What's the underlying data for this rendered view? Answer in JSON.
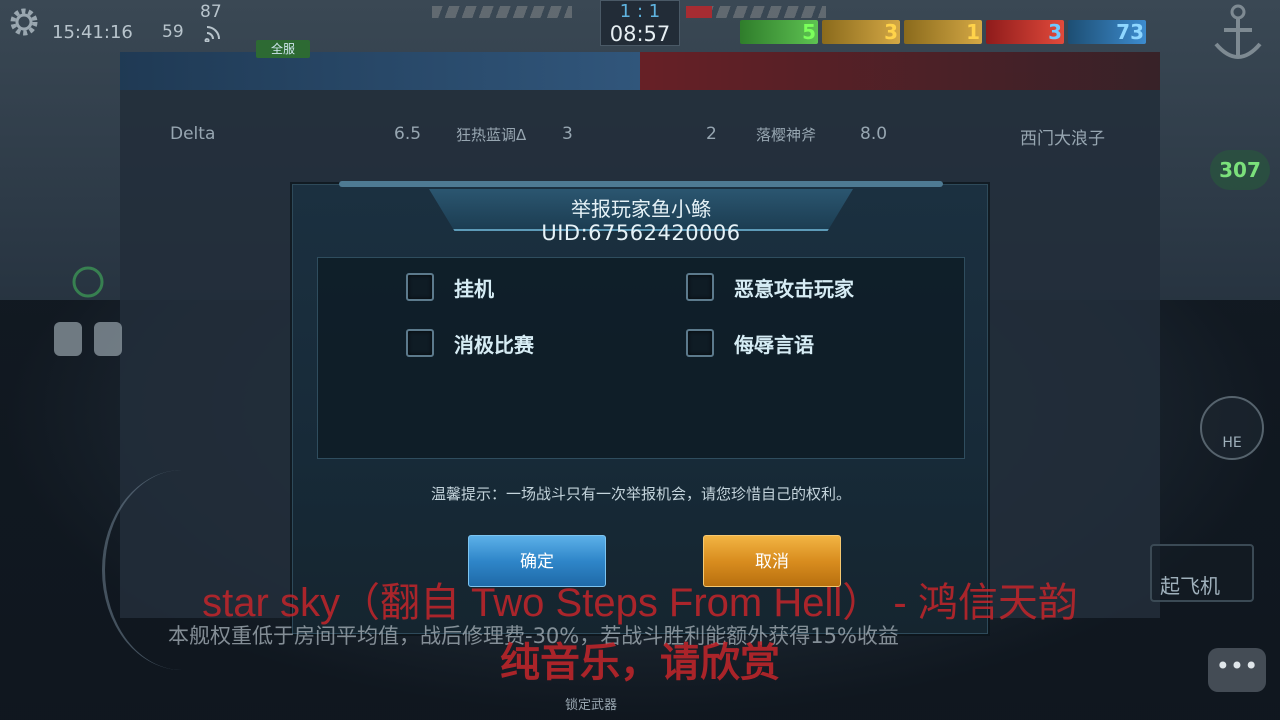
{
  "hud": {
    "clock": "15:41:16",
    "ping": "59",
    "fps": "87",
    "score": "1 : 1",
    "timer": "08:57",
    "class_counts": [
      "5",
      "3",
      "1",
      "3",
      "73"
    ],
    "class_colors": [
      "#5ec252",
      "#d4a845",
      "#d4a845",
      "#e24a3b",
      "#3d8ccf"
    ],
    "all_server_tab": "全服",
    "right_pill": "307",
    "he_button": "HE",
    "plane_button": "起飞机",
    "lock_weapon": "锁定武器",
    "chat_icon": "chat-bubble-icon"
  },
  "scoreboard": {
    "left_row": {
      "name": "Delta",
      "rating": "6.5",
      "player": "狂热蓝调Δ",
      "kills": "3"
    },
    "right_row": {
      "kills": "2",
      "player": "落樱神斧",
      "rating": "8.0",
      "name": "西门大浪子"
    }
  },
  "dialog": {
    "title": "举报玩家鱼小鲦",
    "uid": "UID:67562420006",
    "options": [
      {
        "label": "挂机",
        "checked": false
      },
      {
        "label": "恶意攻击玩家",
        "checked": false
      },
      {
        "label": "消极比赛",
        "checked": false
      },
      {
        "label": "侮辱言语",
        "checked": false
      }
    ],
    "tip": "温馨提示：一场战斗只有一次举报机会，请您珍惜自己的权利。",
    "confirm_label": "确定",
    "cancel_label": "取消",
    "accent_blue": "#2f86c9",
    "accent_orange": "#d98d1f"
  },
  "overlay": {
    "subtitle_line1": "star sky（翻自 Two Steps From Hell） - 鸿信天韵",
    "subtitle_line2": "纯音乐，请欣赏",
    "notice": "本舰权重低于房间平均值，战后修理费-30%，若战斗胜利能额外获得15%收益"
  }
}
